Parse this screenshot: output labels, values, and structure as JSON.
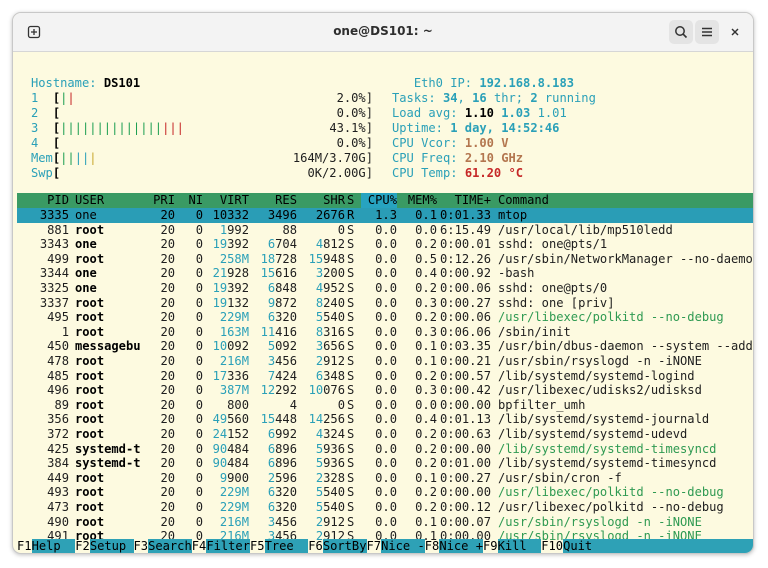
{
  "window": {
    "title": "one@DS101: ~"
  },
  "icons": {
    "new_tab": "new-tab-icon",
    "search": "search-icon",
    "menu": "hamburger-menu-icon",
    "close": "close-icon"
  },
  "meters": {
    "hostname_label": "Hostname:",
    "hostname": "DS101",
    "cpu": [
      {
        "id": "1",
        "value": "2.0%]"
      },
      {
        "id": "2",
        "value": "0.0%]"
      },
      {
        "id": "3",
        "value": "43.1%]"
      },
      {
        "id": "4",
        "value": "0.0%]"
      }
    ],
    "mem_label": "Mem",
    "mem_value": "164M/3.70G]",
    "swp_label": "Swp",
    "swp_value": "0K/2.00G]",
    "eth_label": "Eth0 IP:",
    "eth_ip": "192.168.8.183",
    "tasks_label": "Tasks:",
    "tasks": "34",
    "thr": "16",
    "thr_label": "thr;",
    "running": "2",
    "running_label": "running",
    "load_label": "Load avg:",
    "load1": "1.10",
    "load5": "1.03",
    "load15": "1.01",
    "uptime_label": "Uptime:",
    "uptime": "1 day, 14:52:46",
    "vcor_label": "CPU Vcor:",
    "vcor": "1.00 V",
    "freq_label": "CPU Freq:",
    "freq": "2.10 GHz",
    "temp_label": "CPU Temp:",
    "temp": "61.20 °C"
  },
  "columns": [
    "PID",
    "USER",
    "PRI",
    "NI",
    "VIRT",
    "RES",
    "SHR",
    "S",
    "CPU%",
    "MEM%",
    "TIME+",
    "Command"
  ],
  "processes": [
    [
      "3335",
      "one",
      "20",
      "0",
      "10332",
      "3496",
      "2676",
      "R",
      "1.3",
      "0.1",
      "0:01.33",
      "mtop"
    ],
    [
      "881",
      "root",
      "20",
      "0",
      "1992",
      "88",
      "0",
      "S",
      "0.0",
      "0.0",
      "6:15.49",
      "/usr/local/lib/mp510ledd"
    ],
    [
      "3343",
      "one",
      "20",
      "0",
      "19392",
      "6704",
      "4812",
      "S",
      "0.0",
      "0.2",
      "0:00.01",
      "sshd: one@pts/1"
    ],
    [
      "499",
      "root",
      "20",
      "0",
      "258M",
      "18728",
      "15948",
      "S",
      "0.0",
      "0.5",
      "0:12.26",
      "/usr/sbin/NetworkManager --no-daemon"
    ],
    [
      "3344",
      "one",
      "20",
      "0",
      "21928",
      "15616",
      "3200",
      "S",
      "0.0",
      "0.4",
      "0:00.92",
      "-bash"
    ],
    [
      "3325",
      "one",
      "20",
      "0",
      "19392",
      "6848",
      "4952",
      "S",
      "0.0",
      "0.2",
      "0:00.06",
      "sshd: one@pts/0"
    ],
    [
      "3337",
      "root",
      "20",
      "0",
      "19132",
      "9872",
      "8240",
      "S",
      "0.0",
      "0.3",
      "0:00.27",
      "sshd: one [priv]"
    ],
    [
      "495",
      "root",
      "20",
      "0",
      "229M",
      "6320",
      "5540",
      "S",
      "0.0",
      "0.2",
      "0:00.06",
      "/usr/libexec/polkitd --no-debug"
    ],
    [
      "1",
      "root",
      "20",
      "0",
      "163M",
      "11416",
      "8316",
      "S",
      "0.0",
      "0.3",
      "0:06.06",
      "/sbin/init"
    ],
    [
      "450",
      "messagebu",
      "20",
      "0",
      "10092",
      "5092",
      "3656",
      "S",
      "0.0",
      "0.1",
      "0:03.35",
      "/usr/bin/dbus-daemon --system --address=sys"
    ],
    [
      "478",
      "root",
      "20",
      "0",
      "216M",
      "3456",
      "2912",
      "S",
      "0.0",
      "0.1",
      "0:00.21",
      "/usr/sbin/rsyslogd -n -iNONE"
    ],
    [
      "485",
      "root",
      "20",
      "0",
      "17336",
      "7424",
      "6348",
      "S",
      "0.0",
      "0.2",
      "0:00.57",
      "/lib/systemd/systemd-logind"
    ],
    [
      "496",
      "root",
      "20",
      "0",
      "387M",
      "12292",
      "10076",
      "S",
      "0.0",
      "0.3",
      "0:00.42",
      "/usr/libexec/udisks2/udisksd"
    ],
    [
      "89",
      "root",
      "20",
      "0",
      "800",
      "4",
      "0",
      "S",
      "0.0",
      "0.0",
      "0:00.00",
      "bpfilter_umh"
    ],
    [
      "356",
      "root",
      "20",
      "0",
      "49560",
      "15448",
      "14256",
      "S",
      "0.0",
      "0.4",
      "0:01.13",
      "/lib/systemd/systemd-journald"
    ],
    [
      "372",
      "root",
      "20",
      "0",
      "24152",
      "6992",
      "4324",
      "S",
      "0.0",
      "0.2",
      "0:00.63",
      "/lib/systemd/systemd-udevd"
    ],
    [
      "425",
      "systemd-t",
      "20",
      "0",
      "90484",
      "6896",
      "5936",
      "S",
      "0.0",
      "0.2",
      "0:00.00",
      "/lib/systemd/systemd-timesyncd"
    ],
    [
      "384",
      "systemd-t",
      "20",
      "0",
      "90484",
      "6896",
      "5936",
      "S",
      "0.0",
      "0.2",
      "0:01.00",
      "/lib/systemd/systemd-timesyncd"
    ],
    [
      "449",
      "root",
      "20",
      "0",
      "9900",
      "2596",
      "2328",
      "S",
      "0.0",
      "0.1",
      "0:00.27",
      "/usr/sbin/cron -f"
    ],
    [
      "493",
      "root",
      "20",
      "0",
      "229M",
      "6320",
      "5540",
      "S",
      "0.0",
      "0.2",
      "0:00.00",
      "/usr/libexec/polkitd --no-debug"
    ],
    [
      "473",
      "root",
      "20",
      "0",
      "229M",
      "6320",
      "5540",
      "S",
      "0.0",
      "0.2",
      "0:00.12",
      "/usr/libexec/polkitd --no-debug"
    ],
    [
      "490",
      "root",
      "20",
      "0",
      "216M",
      "3456",
      "2912",
      "S",
      "0.0",
      "0.1",
      "0:00.07",
      "/usr/sbin/rsyslogd -n -iNONE"
    ],
    [
      "491",
      "root",
      "20",
      "0",
      "216M",
      "3456",
      "2912",
      "S",
      "0.0",
      "0.1",
      "0:00.00",
      "/usr/sbin/rsyslogd -n -iNONE"
    ]
  ],
  "thread_rows": [
    7,
    16,
    19,
    21,
    22
  ],
  "fkeys": [
    {
      "key": "F1",
      "label": "Help  "
    },
    {
      "key": "F2",
      "label": "Setup "
    },
    {
      "key": "F3",
      "label": "Search"
    },
    {
      "key": "F4",
      "label": "Filter"
    },
    {
      "key": "F5",
      "label": "Tree  "
    },
    {
      "key": "F6",
      "label": "SortBy"
    },
    {
      "key": "F7",
      "label": "Nice -"
    },
    {
      "key": "F8",
      "label": "Nice +"
    },
    {
      "key": "F9",
      "label": "Kill  "
    },
    {
      "key": "F10",
      "label": "Quit  "
    }
  ],
  "colors": {
    "background": "#fdfae0",
    "header_bar": "#3a9a64",
    "selected_row": "#2a9db6",
    "fkey_label": "#2ea1b6"
  }
}
